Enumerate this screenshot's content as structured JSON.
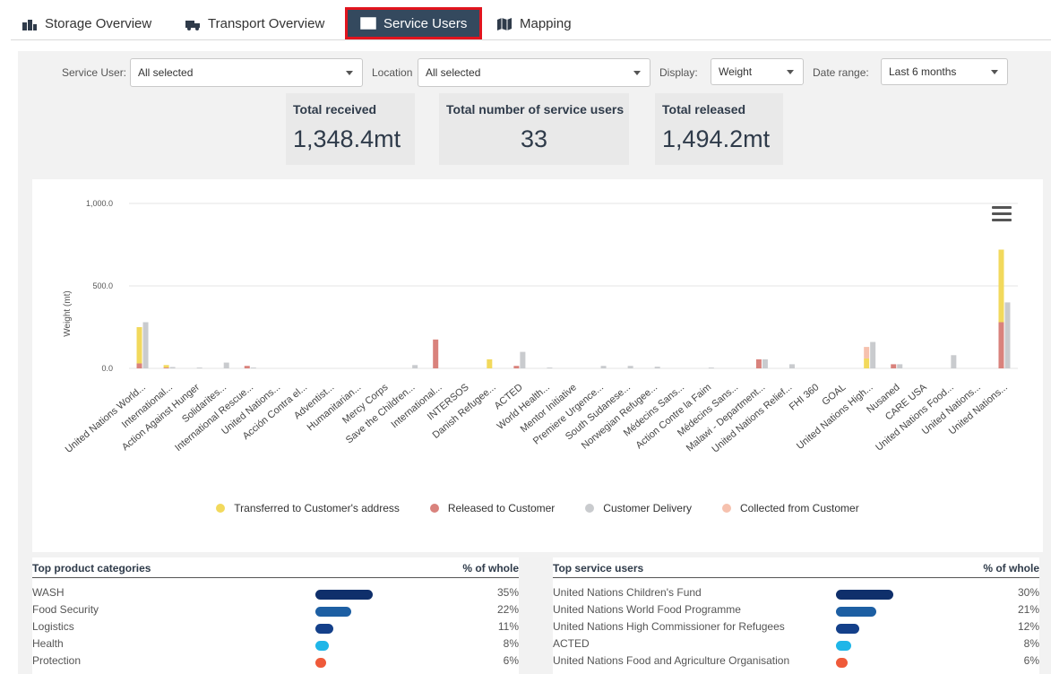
{
  "tabs": [
    {
      "label": "Storage Overview",
      "icon": "warehouse-icon"
    },
    {
      "label": "Transport Overview",
      "icon": "truck-icon"
    },
    {
      "label": "Service Users",
      "icon": "list-icon",
      "active": true
    },
    {
      "label": "Mapping",
      "icon": "map-icon"
    }
  ],
  "filters": {
    "service_user_label": "Service User:",
    "service_user_value": "All selected",
    "location_label": "Location",
    "location_value": "All selected",
    "display_label": "Display:",
    "display_value": "Weight",
    "date_range_label": "Date range:",
    "date_range_value": "Last 6 months"
  },
  "summary": [
    {
      "title": "Total received",
      "value": "1,348.4mt"
    },
    {
      "title": "Total number of service users",
      "value": "33"
    },
    {
      "title": "Total released",
      "value": "1,494.2mt"
    }
  ],
  "chart_data": {
    "type": "bar",
    "ylabel": "Weight (mt)",
    "yticks": [
      "0.0",
      "500.0",
      "1,000.0"
    ],
    "ylim": [
      0,
      1000
    ],
    "grid": true,
    "legend_position": "bottom",
    "categories": [
      "United Nations World...",
      "International...",
      "Action Against Hunger",
      "Solidarites...",
      "International Rescue...",
      "United Nations...",
      "Acción Contra el...",
      "Adventist...",
      "Humanitarian...",
      "Mercy Corps",
      "Save the Children...",
      "International...",
      "INTERSOS",
      "Danish Refugee...",
      "ACTED",
      "World Health...",
      "Mentor Initiative",
      "Premiere Urgence...",
      "South Sudanese...",
      "Norwegian Refugee...",
      "Médecins Sans...",
      "Action Contre la Faim",
      "Médecins Sans...",
      "Malawi - Department...",
      "United Nations Relief...",
      "FHI 360",
      "GOAL",
      "United Nations High...",
      "Nusaned",
      "CARE USA",
      "United Nations Food...",
      "United Nations...",
      "United Nations..."
    ],
    "series": [
      {
        "name": "Transferred to Customer's address",
        "color": "#f2d95c",
        "values": [
          220,
          15,
          0,
          0,
          0,
          0,
          0,
          0,
          0,
          0,
          0,
          0,
          0,
          55,
          0,
          0,
          0,
          0,
          0,
          0,
          0,
          0,
          0,
          0,
          0,
          0,
          0,
          60,
          0,
          0,
          0,
          0,
          440
        ]
      },
      {
        "name": "Released to Customer",
        "color": "#d9827c",
        "values": [
          30,
          5,
          0,
          0,
          15,
          0,
          0,
          0,
          0,
          0,
          0,
          175,
          0,
          0,
          15,
          0,
          0,
          0,
          0,
          0,
          0,
          0,
          0,
          55,
          0,
          0,
          0,
          0,
          25,
          0,
          0,
          0,
          280
        ]
      },
      {
        "name": "Customer Delivery",
        "color": "#c9cbce",
        "values": [
          280,
          8,
          5,
          35,
          5,
          0,
          0,
          0,
          0,
          0,
          20,
          0,
          0,
          0,
          100,
          5,
          0,
          15,
          15,
          10,
          0,
          5,
          0,
          55,
          25,
          0,
          0,
          160,
          25,
          0,
          80,
          0,
          400
        ]
      },
      {
        "name": "Collected from Customer",
        "color": "#f6c1ae",
        "values": [
          0,
          0,
          0,
          0,
          0,
          0,
          0,
          0,
          0,
          0,
          0,
          0,
          0,
          0,
          0,
          0,
          0,
          0,
          0,
          0,
          0,
          0,
          0,
          0,
          0,
          0,
          0,
          70,
          0,
          0,
          0,
          0,
          0
        ]
      }
    ]
  },
  "chart_menu_icon": "hamburger-menu-icon",
  "top_products": {
    "title": "Top product categories",
    "pct_header": "% of whole",
    "rows": [
      {
        "label": "WASH",
        "pct": "35%",
        "value": 35,
        "color": "#0f2f6b"
      },
      {
        "label": "Food Security",
        "pct": "22%",
        "value": 22,
        "color": "#1d5fa3"
      },
      {
        "label": "Logistics",
        "pct": "11%",
        "value": 11,
        "color": "#14408a"
      },
      {
        "label": "Health",
        "pct": "8%",
        "value": 8,
        "color": "#1fb6e8"
      },
      {
        "label": "Protection",
        "pct": "6%",
        "value": 6,
        "color": "#ef5a3a"
      }
    ]
  },
  "top_users": {
    "title": "Top service users",
    "pct_header": "% of whole",
    "rows": [
      {
        "label": "United Nations Children's Fund",
        "pct": "30%",
        "value": 30,
        "color": "#0f2f6b"
      },
      {
        "label": "United Nations World Food Programme",
        "pct": "21%",
        "value": 21,
        "color": "#1d5fa3"
      },
      {
        "label": "United Nations High Commissioner for Refugees",
        "pct": "12%",
        "value": 12,
        "color": "#14408a"
      },
      {
        "label": "ACTED",
        "pct": "8%",
        "value": 8,
        "color": "#1fb6e8"
      },
      {
        "label": "United Nations Food and Agriculture Organisation",
        "pct": "6%",
        "value": 6,
        "color": "#ef5a3a"
      }
    ]
  }
}
